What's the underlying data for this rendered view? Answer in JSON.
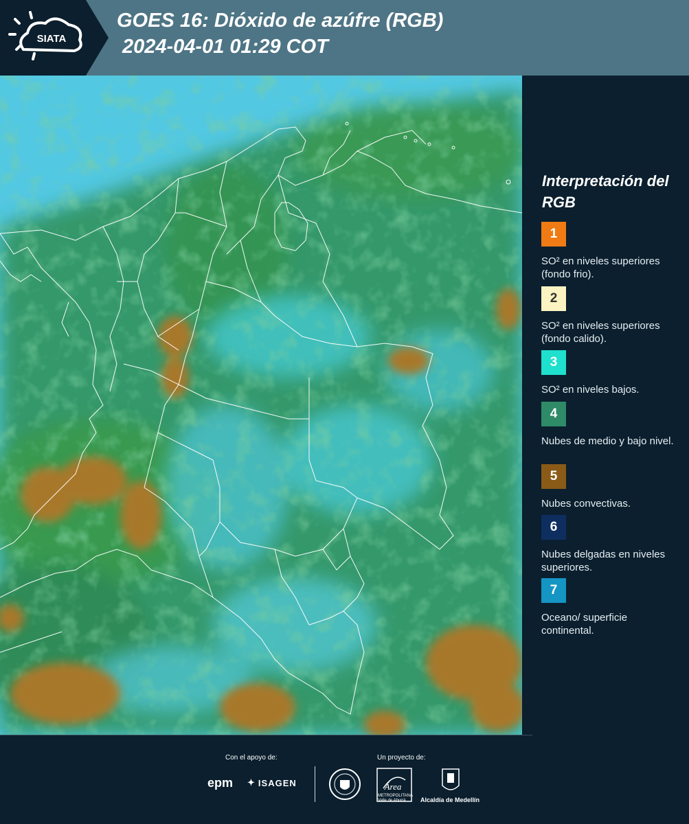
{
  "header": {
    "logo_text": "SIATA",
    "title_line1": "GOES 16: Dióxido de azúfre (RGB)",
    "title_line2": "2024-04-01 01:29 COT",
    "background_color": "#4e7585"
  },
  "legend": {
    "title": "Interpretación del RGB",
    "items": [
      {
        "number": "1",
        "color": "#f07b14",
        "text": "SO² en niveles superiores (fondo frio)."
      },
      {
        "number": "2",
        "color": "#fbf3c1",
        "text": "SO² en niveles superiores (fondo calido)."
      },
      {
        "number": "3",
        "color": "#1ee0cc",
        "text": "SO² en niveles bajos."
      },
      {
        "number": "4",
        "color": "#2f8a68",
        "text": "Nubes de medio y bajo nivel."
      },
      {
        "number": "5",
        "color": "#8a5a17",
        "text": "Nubes convectivas."
      },
      {
        "number": "6",
        "color": "#0e2e60",
        "text": "Nubes delgadas en niveles superiores."
      },
      {
        "number": "7",
        "color": "#1495c4",
        "text": "Oceano/ superficie continental."
      }
    ]
  },
  "footer": {
    "support_caption": "Con el apoyo de:",
    "project_caption": "Un proyecto de:",
    "sponsor_1": "epm",
    "sponsor_2": "ISAGEN",
    "area_name": "Área",
    "area_caption": "METROPOLITANA Valle de Aburrá",
    "alcaldia_label": "Alcaldía de Medellín"
  },
  "map": {
    "colors": {
      "ocean": "#4fc4e0",
      "land_low_cloud": "#2f8f55",
      "convective": "#a8782a",
      "borders": "#ffffff"
    }
  }
}
